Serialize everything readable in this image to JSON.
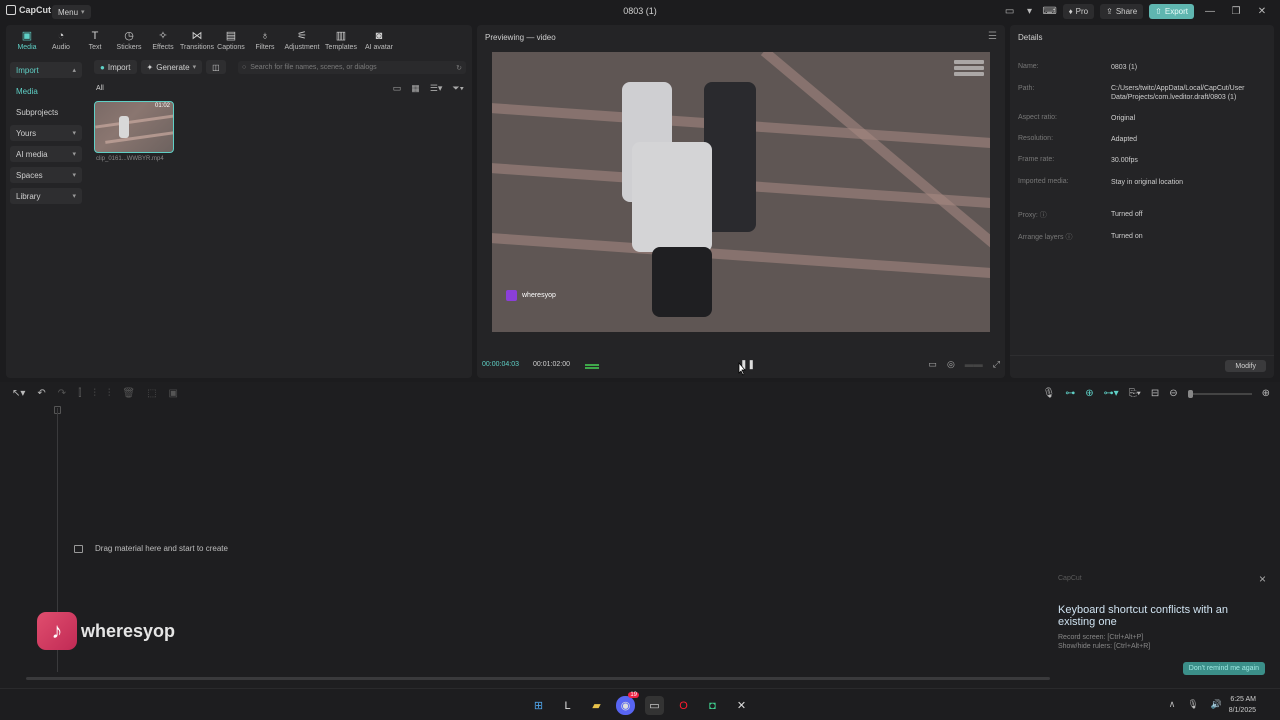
{
  "titlebar": {
    "app_name": "CapCut",
    "menu_label": "Menu",
    "project_title": "0803 (1)",
    "pro_label": "Pro",
    "share_label": "Share",
    "export_label": "Export"
  },
  "toolbar": {
    "items": [
      "Media",
      "Audio",
      "Text",
      "Stickers",
      "Effects",
      "Transitions",
      "Captions",
      "Filters",
      "Adjustment",
      "Templates",
      "AI avatar"
    ]
  },
  "sidebar": {
    "items": [
      "Import",
      "Media",
      "Subprojects",
      "Yours",
      "AI media",
      "Spaces",
      "Library"
    ]
  },
  "media": {
    "import_label": "Import",
    "generate_label": "Generate",
    "search_placeholder": "Search for file names, scenes, or dialogs",
    "filter_label": "All",
    "clip_duration": "01:02",
    "clip_name": "clip_0161...WWBYR.mp4"
  },
  "preview": {
    "title": "Previewing — video",
    "current_time": "00:00:04:03",
    "total_time": "00:01:02:00",
    "watermark": "wheresyop"
  },
  "details": {
    "title": "Details",
    "rows": [
      {
        "label": "Name:",
        "value": "0803 (1)"
      },
      {
        "label": "Path:",
        "value": "C:/Users/twitc/AppData/Local/CapCut/User Data/Projects/com.lveditor.draft/0803 (1)"
      },
      {
        "label": "Aspect ratio:",
        "value": "Original"
      },
      {
        "label": "Resolution:",
        "value": "Adapted"
      },
      {
        "label": "Frame rate:",
        "value": "30.00fps"
      },
      {
        "label": "Imported media:",
        "value": "Stay in original location"
      },
      {
        "label": "Proxy: ⓘ",
        "value": "Turned off"
      },
      {
        "label": "Arrange layers ⓘ",
        "value": "Turned on"
      }
    ],
    "modify_label": "Modify"
  },
  "timeline": {
    "drag_hint": "Drag material here and start to create",
    "playhead_label": "0"
  },
  "toast": {
    "app": "CapCut",
    "title": "Keyboard shortcut conflicts with an existing one",
    "line1": "Record screen: [Ctrl+Alt+P]",
    "line2": "Show/hide rulers: [Ctrl+Alt+R]",
    "button": "Don't remind me again"
  },
  "overlay": {
    "tiktok_name": "wheresyop"
  },
  "taskbar": {
    "time": "6:25 AM",
    "date": "8/1/2025",
    "badge": "19"
  },
  "colors": {
    "accent": "#5fd0c6",
    "export_bg": "#5fb6b0",
    "panel_bg": "#242426"
  }
}
